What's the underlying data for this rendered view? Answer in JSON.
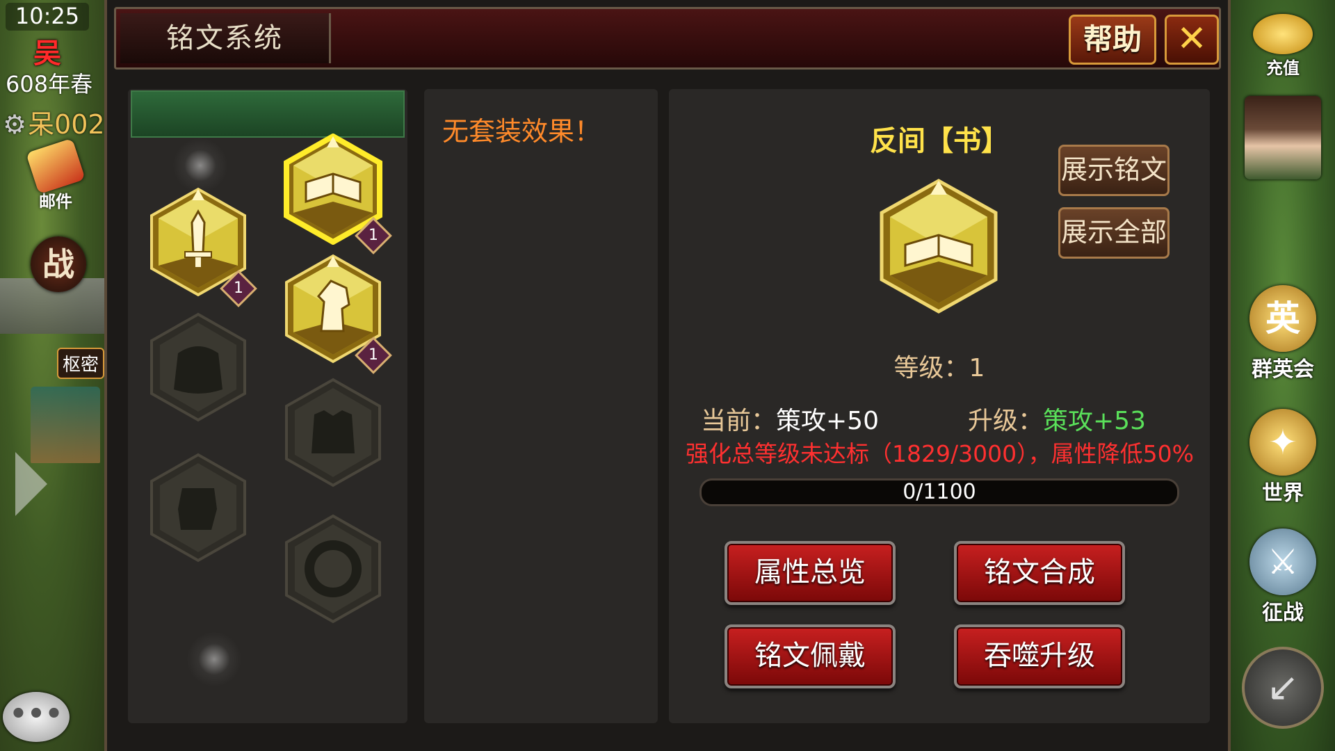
{
  "status": {
    "time": "10:25",
    "faction": "吴",
    "season": "608年春",
    "player_name": "呆002"
  },
  "left_hud": {
    "mail_label": "邮件",
    "battle_label": "战",
    "council_label": "枢密"
  },
  "right_hud": {
    "recharge_label": "充值",
    "heroes_label": "群英会",
    "world_label": "世界",
    "campaign_label": "征战"
  },
  "dialog": {
    "title": "铭文系统",
    "help_label": "帮助",
    "close_glyph": "✕"
  },
  "slots": [
    {
      "kind": "book",
      "level": "1",
      "selected": true,
      "filled": true
    },
    {
      "kind": "sword",
      "level": "1",
      "selected": false,
      "filled": true
    },
    {
      "kind": "horse",
      "level": "1",
      "selected": false,
      "filled": true
    },
    {
      "kind": "cloak",
      "level": "",
      "selected": false,
      "filled": false
    },
    {
      "kind": "armor",
      "level": "",
      "selected": false,
      "filled": false
    },
    {
      "kind": "boots",
      "level": "",
      "selected": false,
      "filled": false
    },
    {
      "kind": "ring",
      "level": "",
      "selected": false,
      "filled": false
    }
  ],
  "set_effect": "无套装效果！",
  "detail": {
    "name": "反间【书】",
    "show_inscription": "展示铭文",
    "show_all": "展示全部",
    "level_label": "等级：1",
    "current_label": "当前：",
    "current_value": "策攻+50",
    "upgrade_label": "升级：",
    "upgrade_value": "策攻+53",
    "warning": "强化总等级未达标（1829/3000），属性降低50%",
    "exp_text": "0/1100",
    "exp_fraction": 0
  },
  "actions": {
    "overview": "属性总览",
    "compose": "铭文合成",
    "equip": "铭文佩戴",
    "devour": "吞噬升级"
  }
}
